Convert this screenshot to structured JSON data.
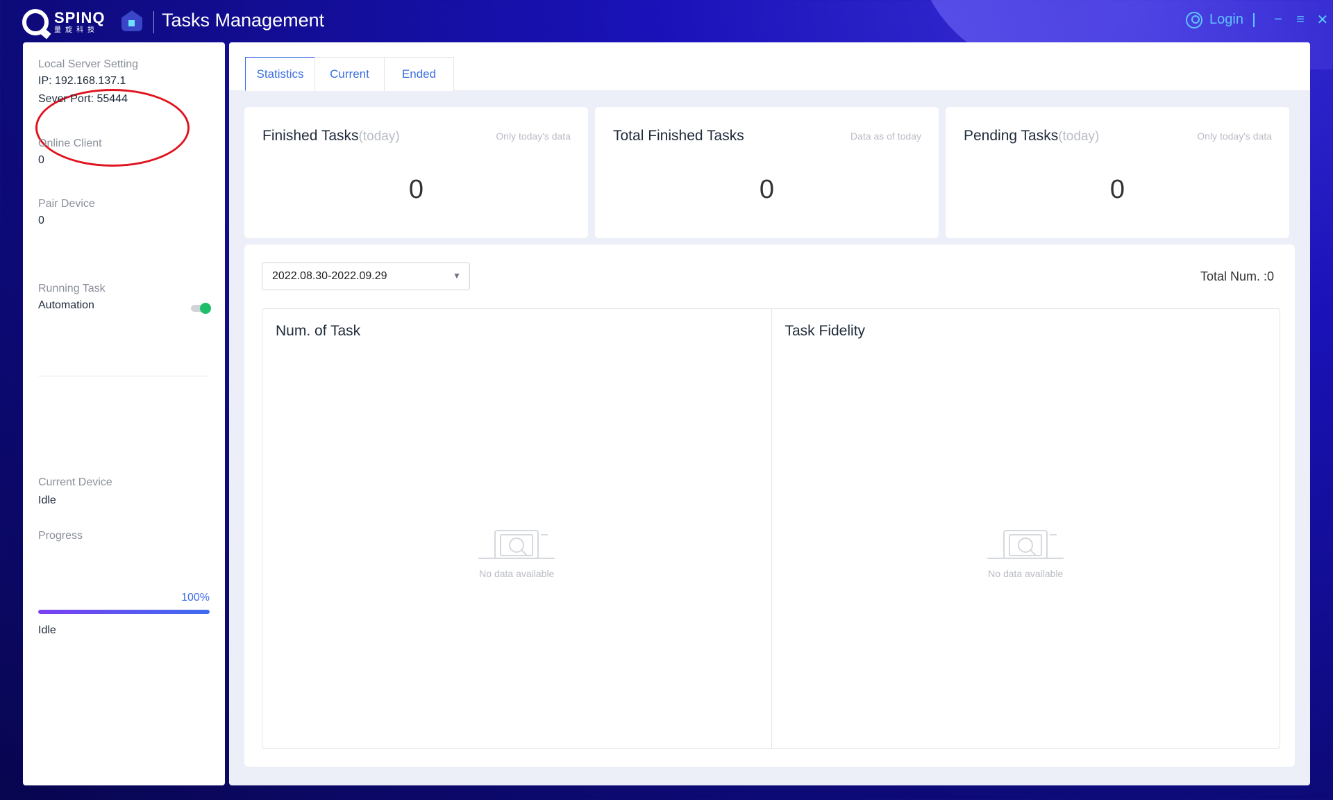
{
  "header": {
    "logo_text": "SPINQ",
    "logo_sub": "量旋科技",
    "app_title": "Tasks Management",
    "login_label": "Login",
    "minimize": "−",
    "menu": "≡",
    "close": "✕",
    "accent_color": "#5fc4ff"
  },
  "sidebar": {
    "server_label": "Local Server Setting",
    "ip_text": "IP: 192.168.137.1",
    "port_text": "Sever Port: 55444",
    "online_label": "Online Client",
    "online_value": "0",
    "pair_label": "Pair Device",
    "pair_value": "0",
    "running_label": "Running Task",
    "running_value": "Automation",
    "automation_on": true,
    "current_device_label": "Current Device",
    "current_device_value": "Idle",
    "progress_label": "Progress",
    "progress_percent_text": "100%",
    "progress_value": 1.0,
    "progress_status": "Idle"
  },
  "tabs": [
    {
      "label": "Statistics",
      "active": true
    },
    {
      "label": "Current",
      "active": false
    },
    {
      "label": "Ended",
      "active": false
    }
  ],
  "cards": [
    {
      "title": "Finished Tasks",
      "suffix": "(today)",
      "note": "Only today's data",
      "value": "0"
    },
    {
      "title": "Total Finished Tasks",
      "suffix": "",
      "note": "Data as of today",
      "value": "0"
    },
    {
      "title": "Pending Tasks",
      "suffix": "(today)",
      "note": "Only today's data",
      "value": "0"
    }
  ],
  "panel": {
    "date_range": "2022.08.30-2022.09.29",
    "total_num": "Total Num. :0",
    "charts": [
      {
        "title": "Num. of Task",
        "empty_text": "No data available"
      },
      {
        "title": "Task Fidelity",
        "empty_text": "No data available"
      }
    ]
  }
}
